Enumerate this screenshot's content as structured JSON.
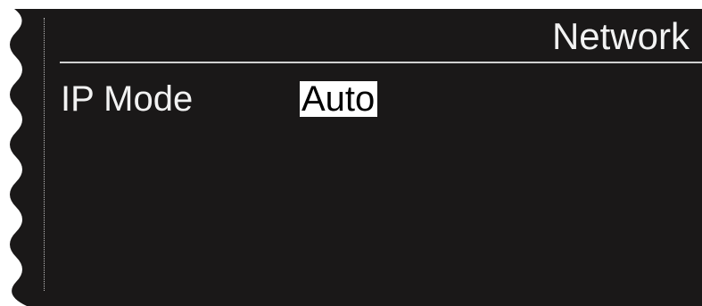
{
  "screen": {
    "title": "Network",
    "colors": {
      "background": "#1a1818",
      "text": "#f2f2f2",
      "selection_background": "#ffffff",
      "selection_text": "#000000"
    }
  },
  "settings": {
    "rows": [
      {
        "label": "IP Mode",
        "value": "Auto",
        "selected": true
      }
    ]
  }
}
